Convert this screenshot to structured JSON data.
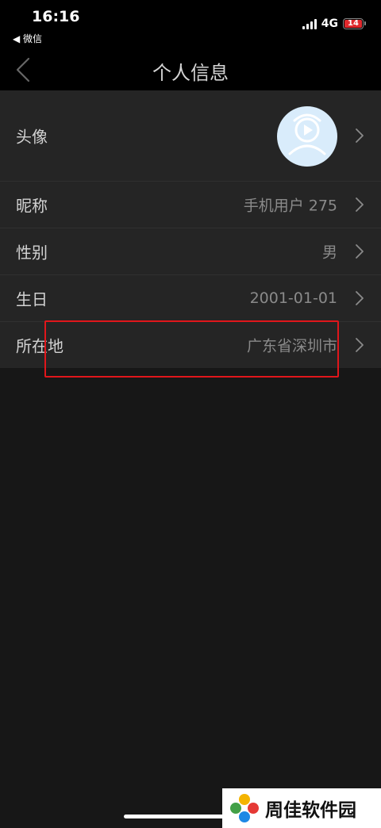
{
  "status_bar": {
    "time": "16:16",
    "back_app": "◀ 微信",
    "network": "4G",
    "battery": "14",
    "battery_color": "#e0292d"
  },
  "nav": {
    "title": "个人信息",
    "back_icon": "chevron-left-icon"
  },
  "profile": {
    "rows": [
      {
        "label": "头像",
        "value": ""
      },
      {
        "label": "昵称",
        "value": "手机用户 275"
      },
      {
        "label": "性别",
        "value": "男"
      },
      {
        "label": "生日",
        "value": "2001-01-01"
      },
      {
        "label": "所在地",
        "value": "广东省深圳市"
      }
    ]
  },
  "watermark": {
    "text": "周佳软件园"
  },
  "colors": {
    "background": "#171717",
    "list_bg": "#252525",
    "highlight": "#e0161b",
    "avatar_bg": "#d9ecfb"
  }
}
